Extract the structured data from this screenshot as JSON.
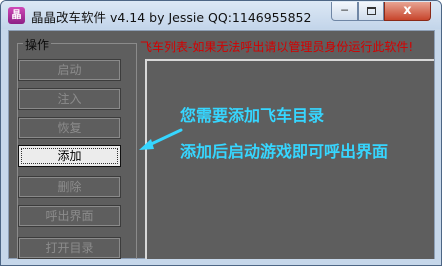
{
  "window": {
    "title": "晶晶改车软件 v4.14 by Jessie QQ:1146955852",
    "icon_name": "app-logo-icon",
    "controls": {
      "minimize": "─",
      "maximize": "□",
      "close": "x"
    }
  },
  "operations": {
    "group_label": "操作",
    "buttons": [
      {
        "label": "启动",
        "enabled": false
      },
      {
        "label": "注入",
        "enabled": false
      },
      {
        "label": "恢复",
        "enabled": false
      },
      {
        "label": "添加",
        "enabled": true,
        "focused": true
      },
      {
        "label": "删除",
        "enabled": false
      },
      {
        "label": "呼出界面",
        "enabled": false
      },
      {
        "label": "打开目录",
        "enabled": false
      }
    ]
  },
  "vehicle_list": {
    "title": "飞车列表-如果无法呼出请以管理员身份运行此软件!",
    "items": []
  },
  "annotation": {
    "line1": "您需要添加飞车目录",
    "line2": "添加后启动游戏即可呼出界面",
    "arrow_icon": "arrow-pointer-icon"
  },
  "colors": {
    "client_bg": "#5e5e5e",
    "list_title": "#d40000",
    "annotation": "#36d6ff",
    "active_button_bg": "#ececec"
  }
}
